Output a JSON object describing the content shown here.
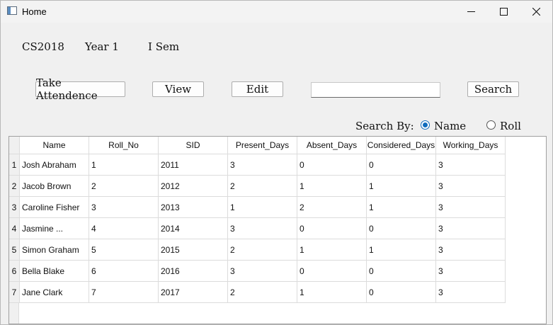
{
  "window": {
    "title": "Home",
    "minimize_icon": "minimize-icon",
    "maximize_icon": "maximize-icon",
    "close_icon": "close-icon"
  },
  "info": {
    "course": "CS2018",
    "year": "Year 1",
    "semester": "I Sem"
  },
  "toolbar": {
    "take_attendance_label": "Take Attendence",
    "view_label": "View",
    "edit_label": "Edit",
    "search_label": "Search",
    "search_value": ""
  },
  "search_by": {
    "label": "Search By:",
    "options": [
      "Name",
      "Roll"
    ],
    "selected": "Name"
  },
  "table": {
    "columns": [
      "Name",
      "Roll_No",
      "SID",
      "Present_Days",
      "Absent_Days",
      "Considered_Days",
      "Working_Days"
    ],
    "rows": [
      {
        "num": "1",
        "cells": [
          "Josh Abraham",
          "1",
          "2011",
          "3",
          "0",
          "0",
          "3"
        ]
      },
      {
        "num": "2",
        "cells": [
          "Jacob Brown",
          "2",
          "2012",
          "2",
          "1",
          "1",
          "3"
        ]
      },
      {
        "num": "3",
        "cells": [
          "Caroline Fisher",
          "3",
          "2013",
          "1",
          "2",
          "1",
          "3"
        ]
      },
      {
        "num": "4",
        "cells": [
          "Jasmine ...",
          "4",
          "2014",
          "3",
          "0",
          "0",
          "3"
        ]
      },
      {
        "num": "5",
        "cells": [
          "Simon Graham",
          "5",
          "2015",
          "2",
          "1",
          "1",
          "3"
        ]
      },
      {
        "num": "6",
        "cells": [
          "Bella Blake",
          "6",
          "2016",
          "3",
          "0",
          "0",
          "3"
        ]
      },
      {
        "num": "7",
        "cells": [
          "Jane Clark",
          "7",
          "2017",
          "2",
          "1",
          "0",
          "3"
        ]
      }
    ]
  }
}
